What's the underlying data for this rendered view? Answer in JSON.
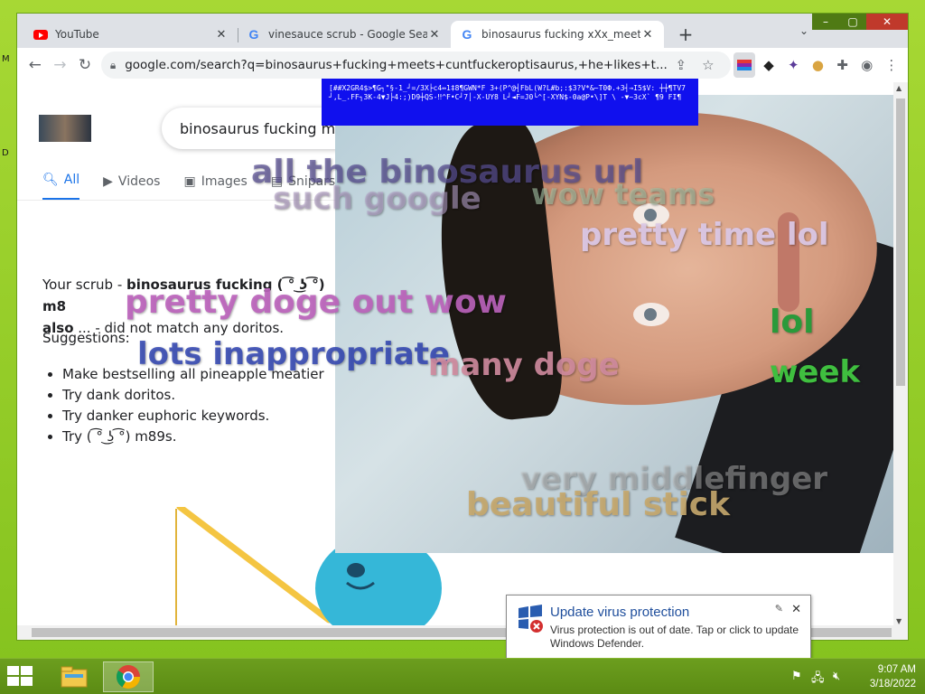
{
  "browser": {
    "tabs": [
      {
        "title": "YouTube",
        "favicon": "youtube-icon"
      },
      {
        "title": "vinesauce scrub - Google Search",
        "favicon": "google-icon"
      },
      {
        "title": "binosaurus fucking xXx_meets_xXx",
        "favicon": "google-icon",
        "active": true
      }
    ],
    "url": "google.com/search?q=binosaurus+fucking+meets+cuntfuckeroptisaurus,+he+likes+t..."
  },
  "search": {
    "query": "binosaurus fucking mee",
    "nav_tabs": [
      "All",
      "Videos",
      "Images",
      "Snipars"
    ],
    "result_prefix": "Your scrub - ",
    "result_bold": "binosaurus fucking ( ͡° ͜ʖ ͡°) m8",
    "result_line2_bold": "also",
    "result_line2": " ... - did not match any doritos.",
    "suggestions_title": "Suggestions:",
    "suggestions": [
      "Make bestselling all pineapple meatier",
      "Try dank doritos.",
      "Try danker euphoric keywords.",
      "Try ( ͡° ͜ʖ ͡°) m89s."
    ]
  },
  "overlay": {
    "corrupt_text": "[##X2GR4$>¶G┐\"§-1_┘=/3X├c4↔1‡8¶GWN*F 3+(P^@┤FbL(W?L#b;:$3?V*&~T0Ф.+3┤→I5$V: ┼┼¶TV7┘,L_.FF┐3K-4▼J├4:;)D9┼QS-‼^F•C┘7│-X-UY8 L┘◄F=J0└^[-XYN$-0a@P•\\]T \\ -▼~3cX` ¶9 FI¶",
    "doge_texts": [
      "all the binosaurus url",
      "such google",
      "wow teams",
      "pretty time lol",
      "pretty doge out wow",
      "lol",
      "lots inappropriate",
      "many doge",
      "week",
      "very middlefinger",
      "beautiful stick"
    ]
  },
  "notification": {
    "title": "Update virus protection",
    "body": "Virus protection is out of date. Tap or click to update Windows Defender."
  },
  "taskbar": {
    "time": "9:07 AM",
    "date": "3/18/2022"
  },
  "desktop": {
    "letters": [
      "M",
      "D"
    ]
  }
}
